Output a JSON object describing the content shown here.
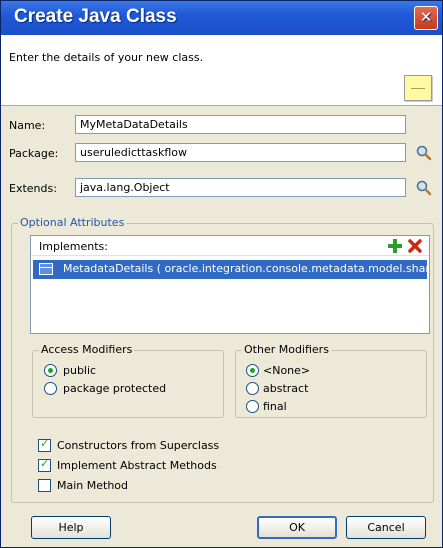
{
  "window": {
    "title": "Create Java Class",
    "close_glyph": "✕"
  },
  "header": {
    "description": "Enter the details of your new class."
  },
  "form": {
    "name_label": "Name:",
    "name_value": "MyMetaDataDetails",
    "package_label": "Package:",
    "package_value": "useruledicttaskflow",
    "extends_label": "Extends:",
    "extends_value": "java.lang.Object"
  },
  "optional_attributes": {
    "title": "Optional Attributes",
    "implements_label": "Implements:",
    "add_icon": "plus-icon",
    "remove_icon": "x-icon",
    "implements_items": [
      "MetadataDetails ( oracle.integration.console.metadata.model.share )"
    ],
    "access_modifiers": {
      "title": "Access Modifiers",
      "options": [
        "public",
        "package protected"
      ],
      "selected": "public"
    },
    "other_modifiers": {
      "title": "Other Modifiers",
      "options": [
        "<None>",
        "abstract",
        "final"
      ],
      "selected": "<None>"
    }
  },
  "checkboxes": [
    {
      "label": "Constructors from Superclass",
      "checked": true
    },
    {
      "label": "Implement Abstract Methods",
      "checked": true
    },
    {
      "label": "Main Method",
      "checked": false
    }
  ],
  "buttons": {
    "help": "Help",
    "ok": "OK",
    "cancel": "Cancel"
  }
}
